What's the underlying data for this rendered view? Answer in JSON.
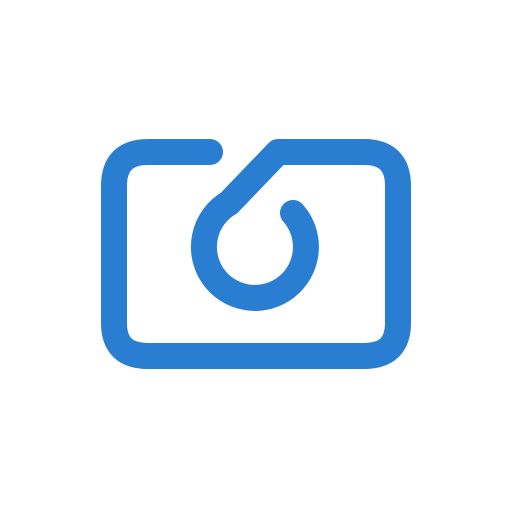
{
  "app": {
    "icon_name": "camera-logo-icon",
    "colors": {
      "background": "#ffffff",
      "brand": "#2a7ed2"
    }
  }
}
